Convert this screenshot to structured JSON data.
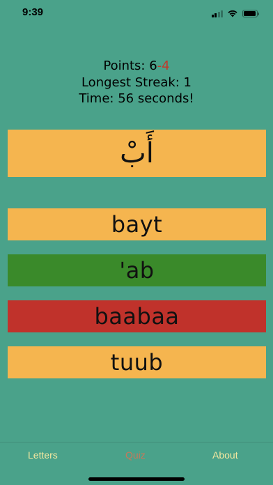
{
  "status_bar": {
    "time": "9:39",
    "icons": [
      "signal-icon",
      "wifi-icon",
      "battery-icon"
    ]
  },
  "stats": {
    "points_label": "Points: ",
    "points_correct": "6",
    "points_separator": "-",
    "points_wrong": "4",
    "longest_streak": "Longest Streak: 1",
    "time_elapsed": "Time: 56 seconds!"
  },
  "question": {
    "letter": "أَبْ"
  },
  "answers": [
    {
      "label": "bayt",
      "state": "neutral"
    },
    {
      "label": "'ab",
      "state": "correct"
    },
    {
      "label": "baabaa",
      "state": "incorrect"
    },
    {
      "label": "tuub",
      "state": "neutral"
    }
  ],
  "tabs": [
    {
      "label": "Letters",
      "active": false
    },
    {
      "label": "Quiz",
      "active": true
    },
    {
      "label": "About",
      "active": false
    }
  ],
  "colors": {
    "background": "#4aa28a",
    "tile_neutral": "#f5b54f",
    "tile_correct": "#3a8a2a",
    "tile_incorrect": "#c0322b",
    "points_penalty": "#c0392b",
    "tab_inactive": "#f4e8a0",
    "tab_active": "#c7785a"
  }
}
